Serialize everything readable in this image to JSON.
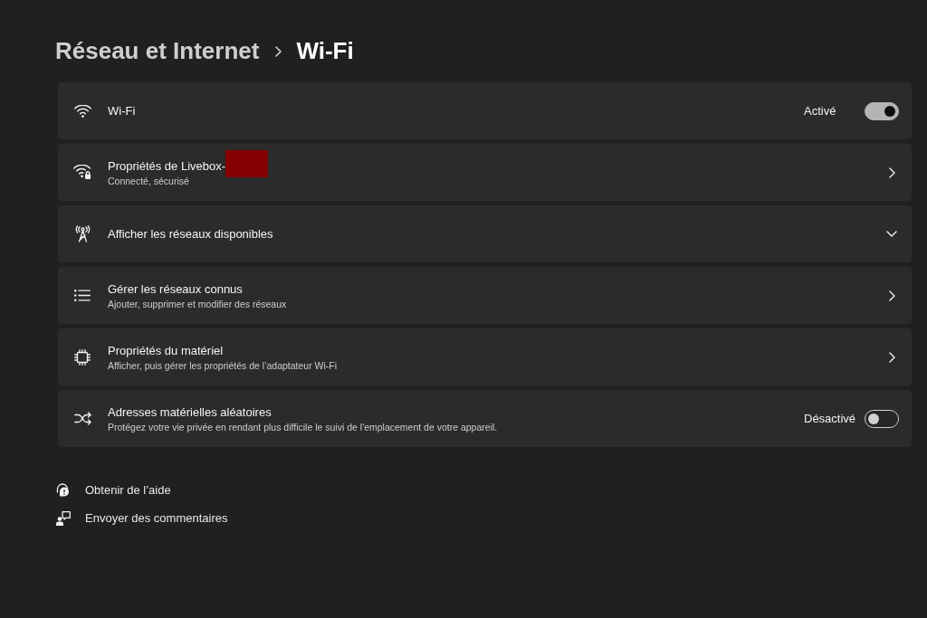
{
  "breadcrumb": {
    "parent": "Réseau et Internet",
    "current": "Wi-Fi"
  },
  "settings": [
    {
      "kind": "toggle",
      "title": "Wi-Fi",
      "status": "Activé",
      "on": true
    },
    {
      "kind": "link",
      "title": "Propriétés de Livebox-",
      "subtitle": "Connecté, sécurisé",
      "redacted": true
    },
    {
      "kind": "expand",
      "title": "Afficher les réseaux disponibles",
      "expanded": false
    },
    {
      "kind": "link",
      "title": "Gérer les réseaux connus",
      "subtitle": "Ajouter, supprimer et modifier des réseaux"
    },
    {
      "kind": "link",
      "title": "Propriétés du matériel",
      "subtitle": "Afficher, puis gérer les propriétés de l’adaptateur Wi-Fi"
    },
    {
      "kind": "toggle",
      "title": "Adresses matérielles aléatoires",
      "subtitle": "Protégez votre vie privée en rendant plus difficile le suivi de l'emplacement de votre appareil.",
      "status": "Désactivé",
      "on": false
    }
  ],
  "footer_links": [
    {
      "label": "Obtenir de l’aide"
    },
    {
      "label": "Envoyer des commentaires"
    }
  ]
}
